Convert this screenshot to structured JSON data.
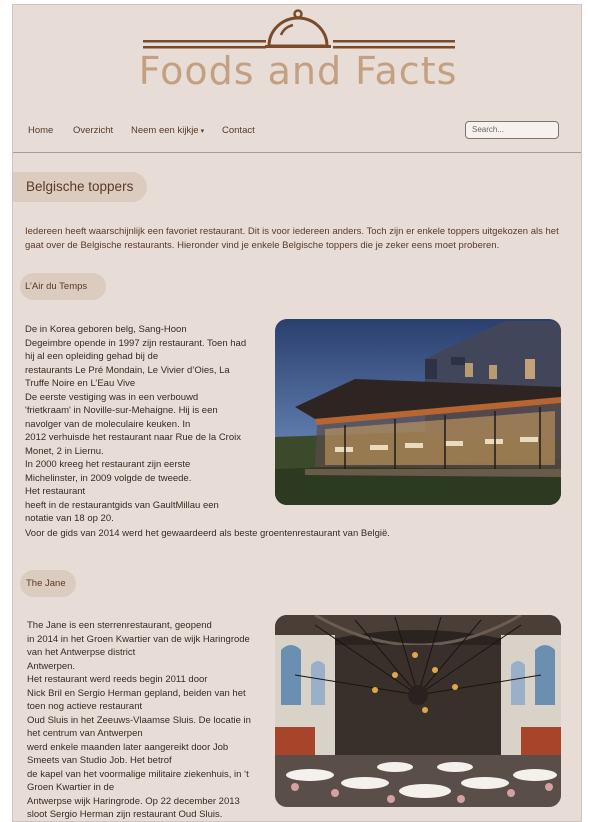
{
  "brand": {
    "title": "Foods and Facts",
    "icon": "cloche-icon"
  },
  "nav": {
    "items": [
      "Home",
      "Overzicht",
      "Neem een kijkje",
      "Contact"
    ],
    "caret": "▾",
    "search_placeholder": "Search..."
  },
  "page": {
    "heading": "Belgische toppers",
    "intro": "Iedereen heeft waarschijnlijk een favoriet restaurant. Dit is voor iedereen anders. Toch zijn er enkele toppers uitgekozen als het gaat over de Belgische restaurants. Hieronder vind je enkele Belgische toppers die je zeker eens moet proberen."
  },
  "restaurants": [
    {
      "name": "L’Air du Temps",
      "text": "De in Korea geboren belg, Sang-Hoon\nDegeimbre opende in 1997 zijn restaurant. Toen had\nhij al een opleiding gehad bij de\nrestaurants Le Pré Mondain, Le Vivier d’Oies,  La\nTruffe Noire en L’Eau Vive\nDe eerste vestiging was in een verbouwd\n'frietkraam' in Noville-sur-Mehaigne. Hij is een\nnavolger van de moleculaire keuken. In\n2012 verhuisde het restaurant naar Rue de la Croix\nMonet, 2 in Liernu.\nIn 2000 kreeg het restaurant zijn eerste\nMichelinster, in 2009 volgde de tweede.\nHet restaurant\nheeft in de restaurantgids van GaultMillau een\nnotatie van 18 op 20.",
      "footer": "Voor de gids van 2014 werd het gewaardeerd als beste groentenrestaurant van België."
    },
    {
      "name": "The Jane",
      "text": "The Jane is een sterrenrestaurant, geopend\nin 2014 in het Groen Kwartier van de wijk Haringrode\nvan het Antwerpse district\nAntwerpen.\nHet restaurant werd reeds begin 2011 door\nNick Bril en Sergio Herman gepland, beiden van het\ntoen nog actieve restaurant\nOud Sluis in het Zeeuws-Vlaamse Sluis. De locatie in\nhet centrum van Antwerpen\nwerd enkele maanden later aangereikt door Job\nSmeets van Studio Job. Het betrof\nde kapel van het voormalige militaire ziekenhuis, in ‘t\nGroen Kwartier in de\nAntwerpse wijk Haringrode. Op 22 december 2013\nsloot Sergio Herman zijn restaurant Oud Sluis."
    }
  ]
}
